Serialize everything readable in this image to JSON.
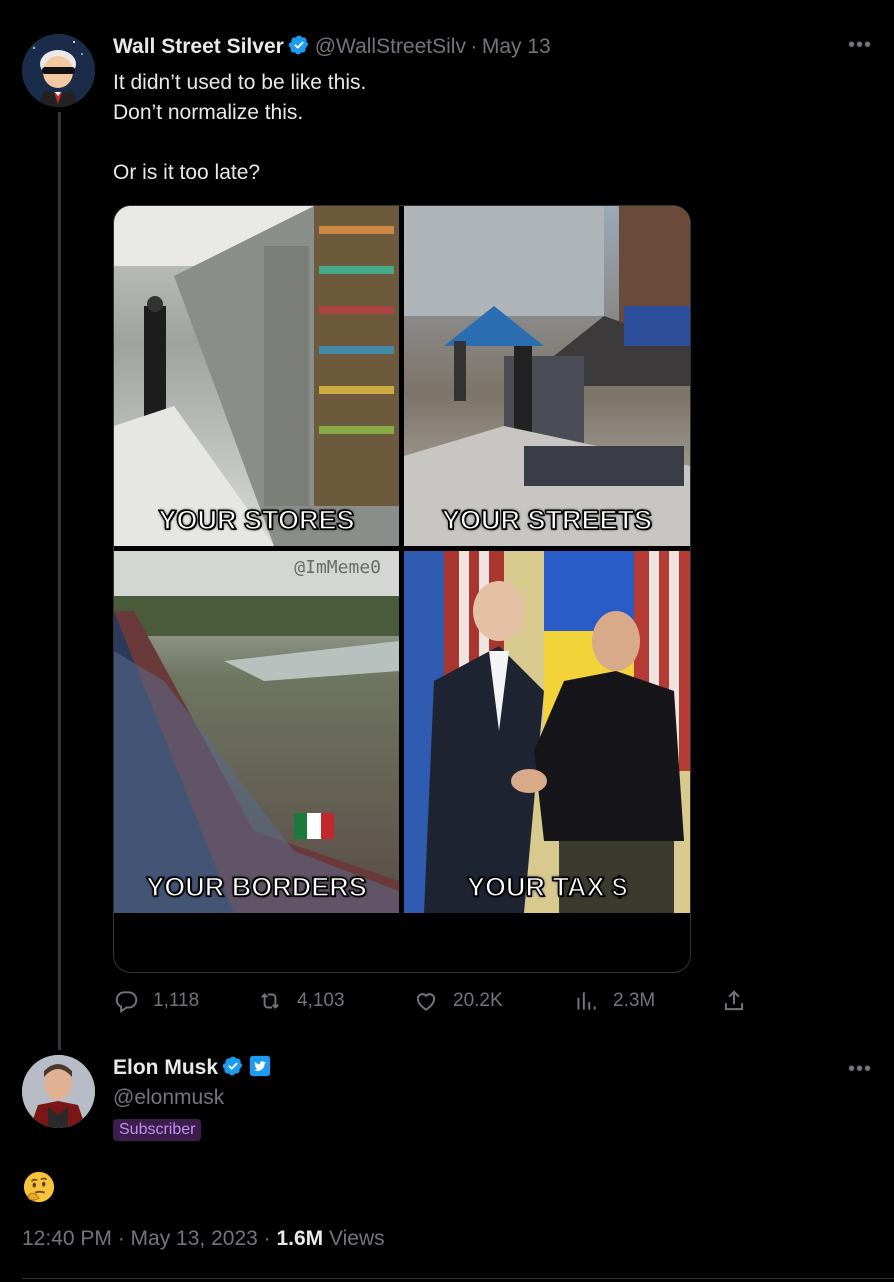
{
  "tweet1": {
    "author_name": "Wall Street Silver",
    "handle": "@WallStreetSilv",
    "separator": "·",
    "date": "May 13",
    "text": "It didn’t used to be like this.\nDon’t normalize this.\n\nOr is it too late?",
    "more_icon": "more-horizontal-icon",
    "media": {
      "panels": [
        {
          "caption": "YOUR STORES"
        },
        {
          "caption": "YOUR STREETS"
        },
        {
          "caption": "YOUR BORDERS"
        },
        {
          "caption": "YOUR TAX $"
        }
      ],
      "watermark": "@ImMeme0"
    },
    "actions": {
      "replies": "1,118",
      "retweets": "4,103",
      "likes": "20.2K",
      "views": "2.3M"
    }
  },
  "tweet2": {
    "author_name": "Elon Musk",
    "handle": "@elonmusk",
    "badge": "Subscriber",
    "emoji": "thinking-face",
    "timestamp": "12:40 PM · May 13, 2023 · ",
    "views_count": "1.6M",
    "views_label": " Views"
  },
  "colors": {
    "background": "#000000",
    "text": "#e7e9ea",
    "secondary": "#71767b",
    "verified_blue": "#1d9bf0",
    "subscriber_bg": "#3d1d4b",
    "subscriber_text": "#c38ef0"
  }
}
